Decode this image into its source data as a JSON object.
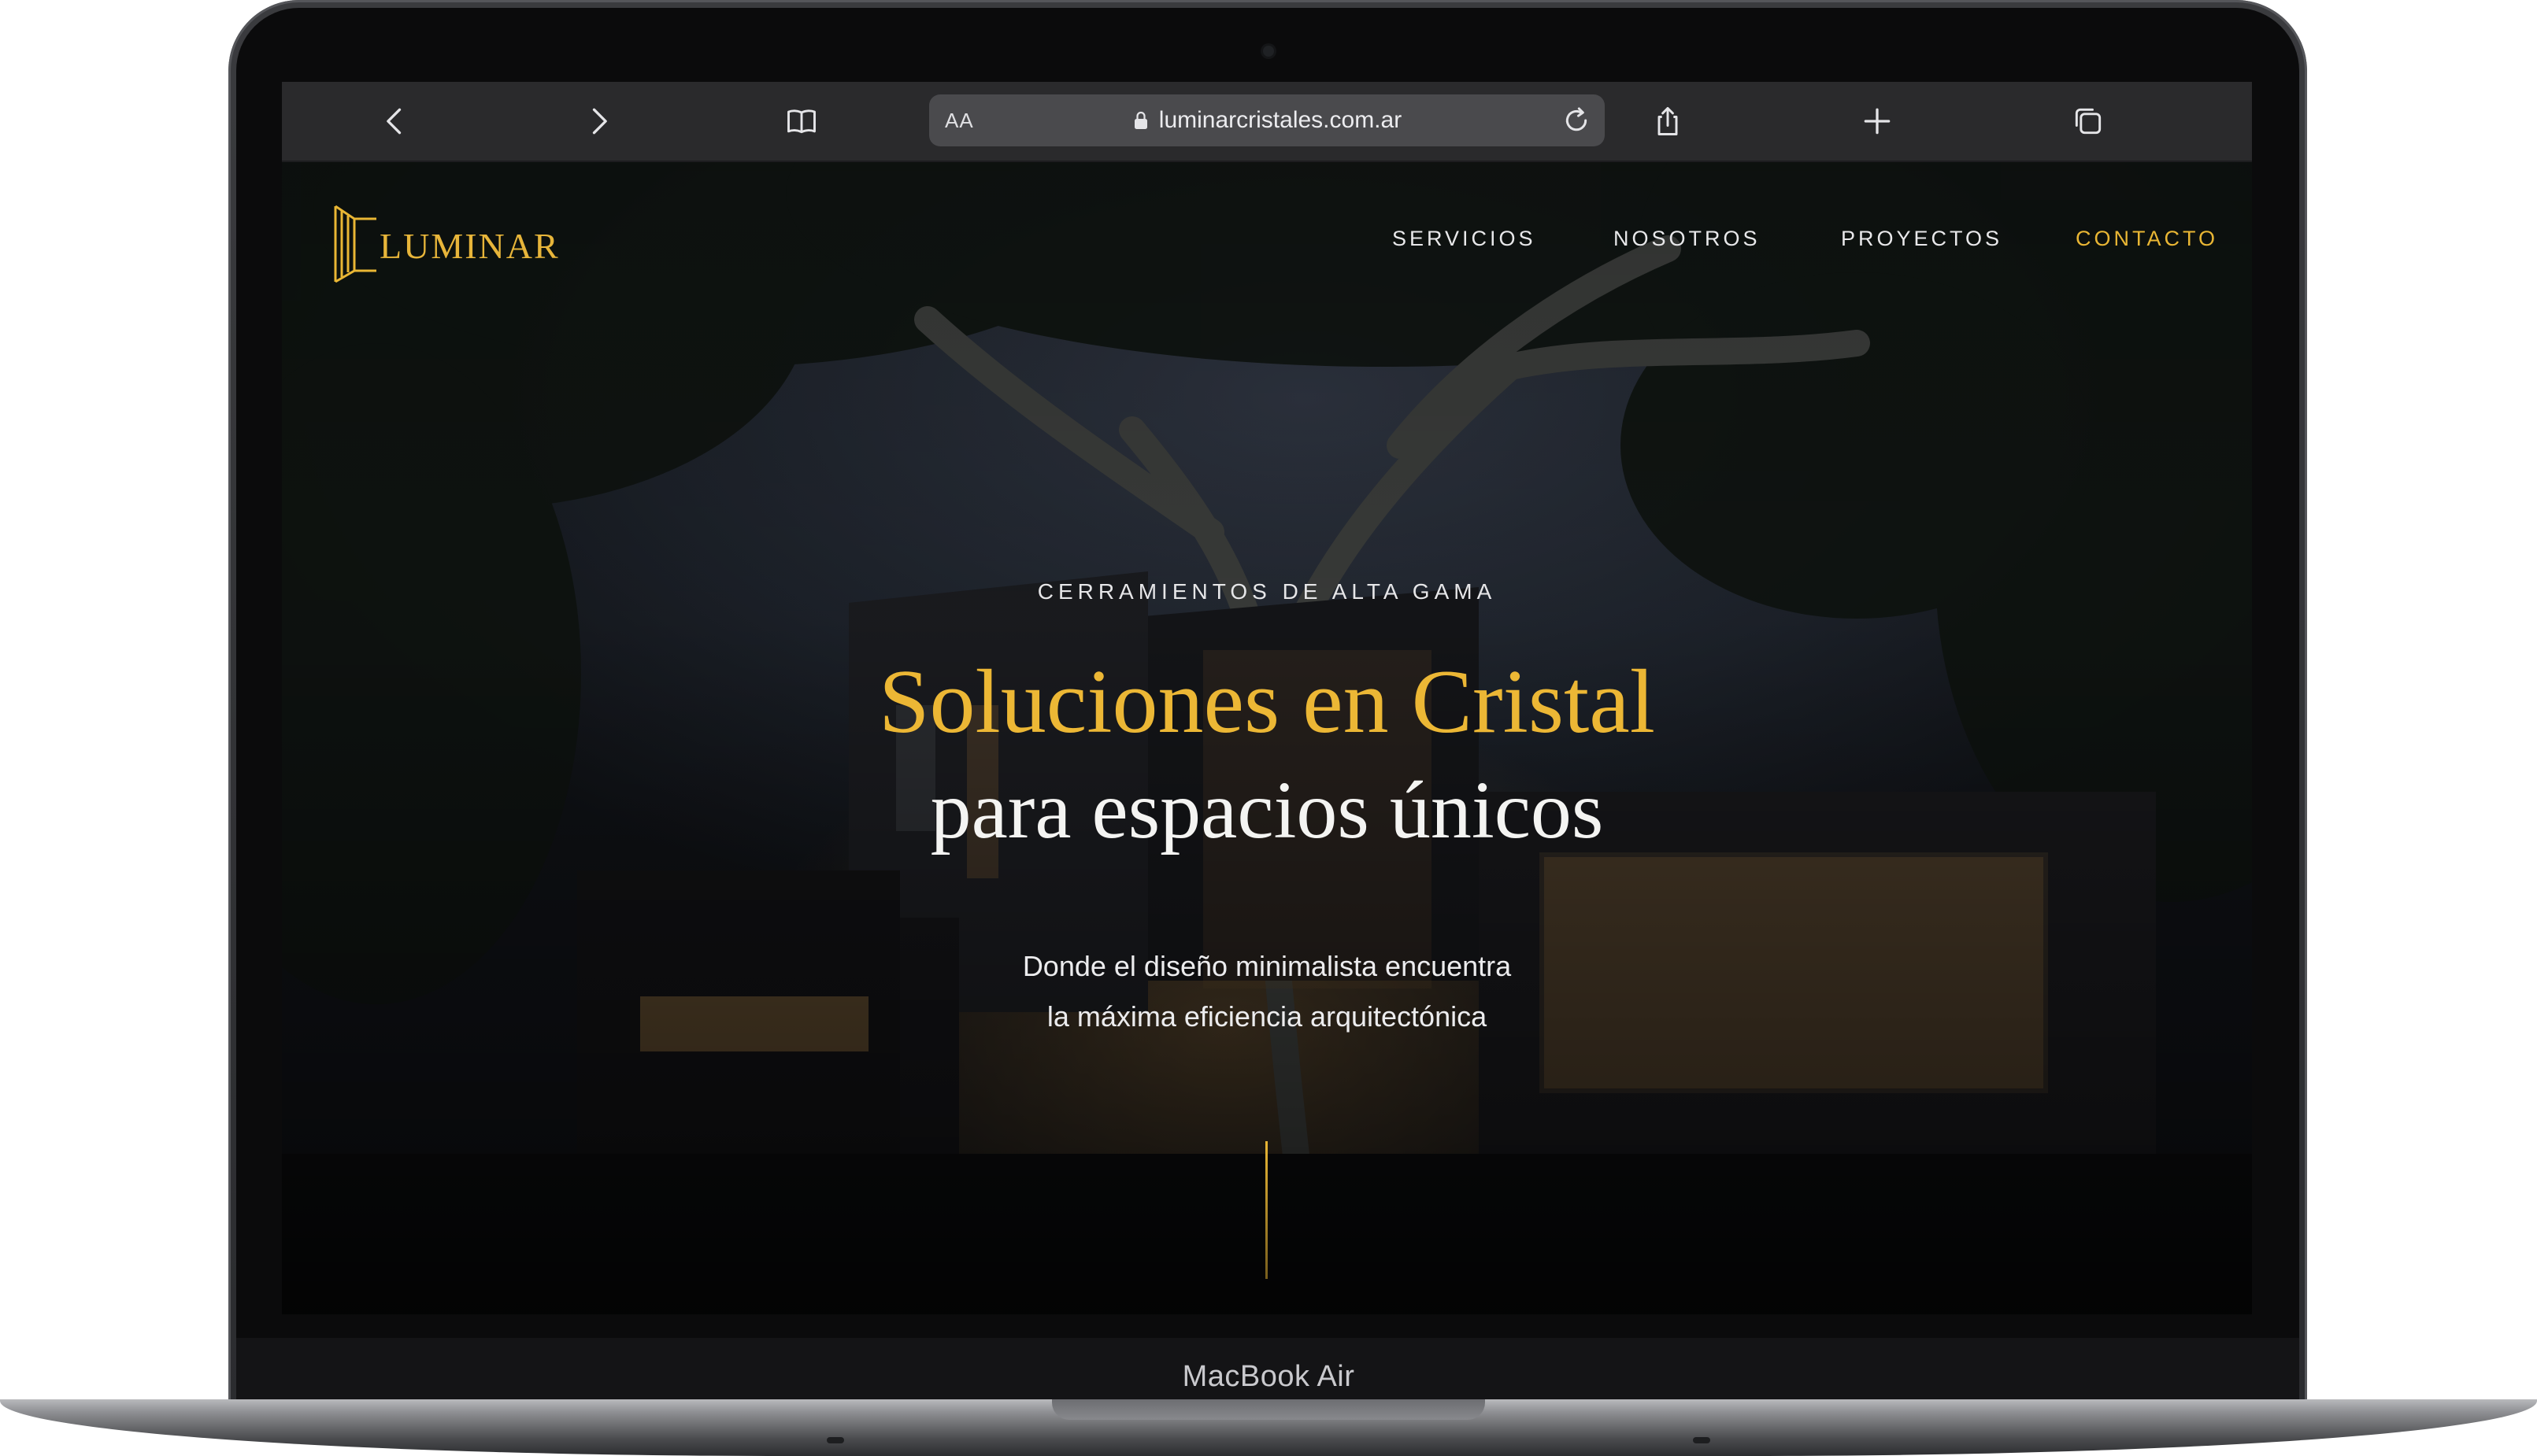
{
  "browser": {
    "address": {
      "text_size_label": "AA",
      "url": "luminarcristales.com.ar"
    },
    "icons": {
      "back": "chevron-left-icon",
      "forward": "chevron-right-icon",
      "bookmarks": "book-icon",
      "lock": "lock-icon",
      "reload": "reload-icon",
      "share": "share-icon",
      "new_tab": "plus-icon",
      "tabs": "tabs-icon"
    }
  },
  "site": {
    "brand": "LUMINAR",
    "nav": [
      {
        "label": "SERVICIOS"
      },
      {
        "label": "NOSOTROS"
      },
      {
        "label": "PROYECTOS"
      },
      {
        "label": "CONTACTO"
      }
    ],
    "active_nav": "CONTACTO",
    "hero": {
      "eyebrow": "CERRAMIENTOS DE ALTA GAMA",
      "title_line1": "Soluciones en Cristal",
      "title_line2": "para espacios únicos",
      "subtitle_line1": "Donde el diseño minimalista encuentra",
      "subtitle_line2": "la máxima eficiencia arquitectónica"
    },
    "colors": {
      "accent": "#E9B634",
      "text": "#F4F4F2",
      "toolbar": "#2A2A2C"
    }
  },
  "device": {
    "model": "MacBook Air"
  }
}
